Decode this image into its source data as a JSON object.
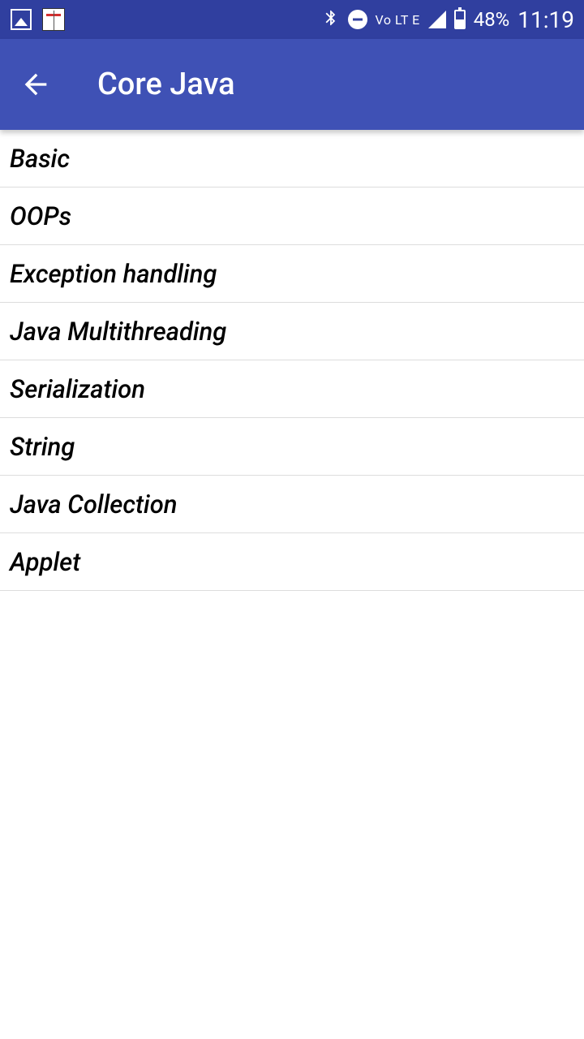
{
  "status": {
    "volte": "Vo LT E",
    "battery_pct": "48%",
    "time": "11:19"
  },
  "header": {
    "title": "Core Java"
  },
  "list": {
    "items": [
      {
        "label": "Basic"
      },
      {
        "label": "OOPs"
      },
      {
        "label": "Exception handling"
      },
      {
        "label": "Java Multithreading"
      },
      {
        "label": "Serialization"
      },
      {
        "label": "String"
      },
      {
        "label": "Java Collection"
      },
      {
        "label": "Applet"
      }
    ]
  }
}
